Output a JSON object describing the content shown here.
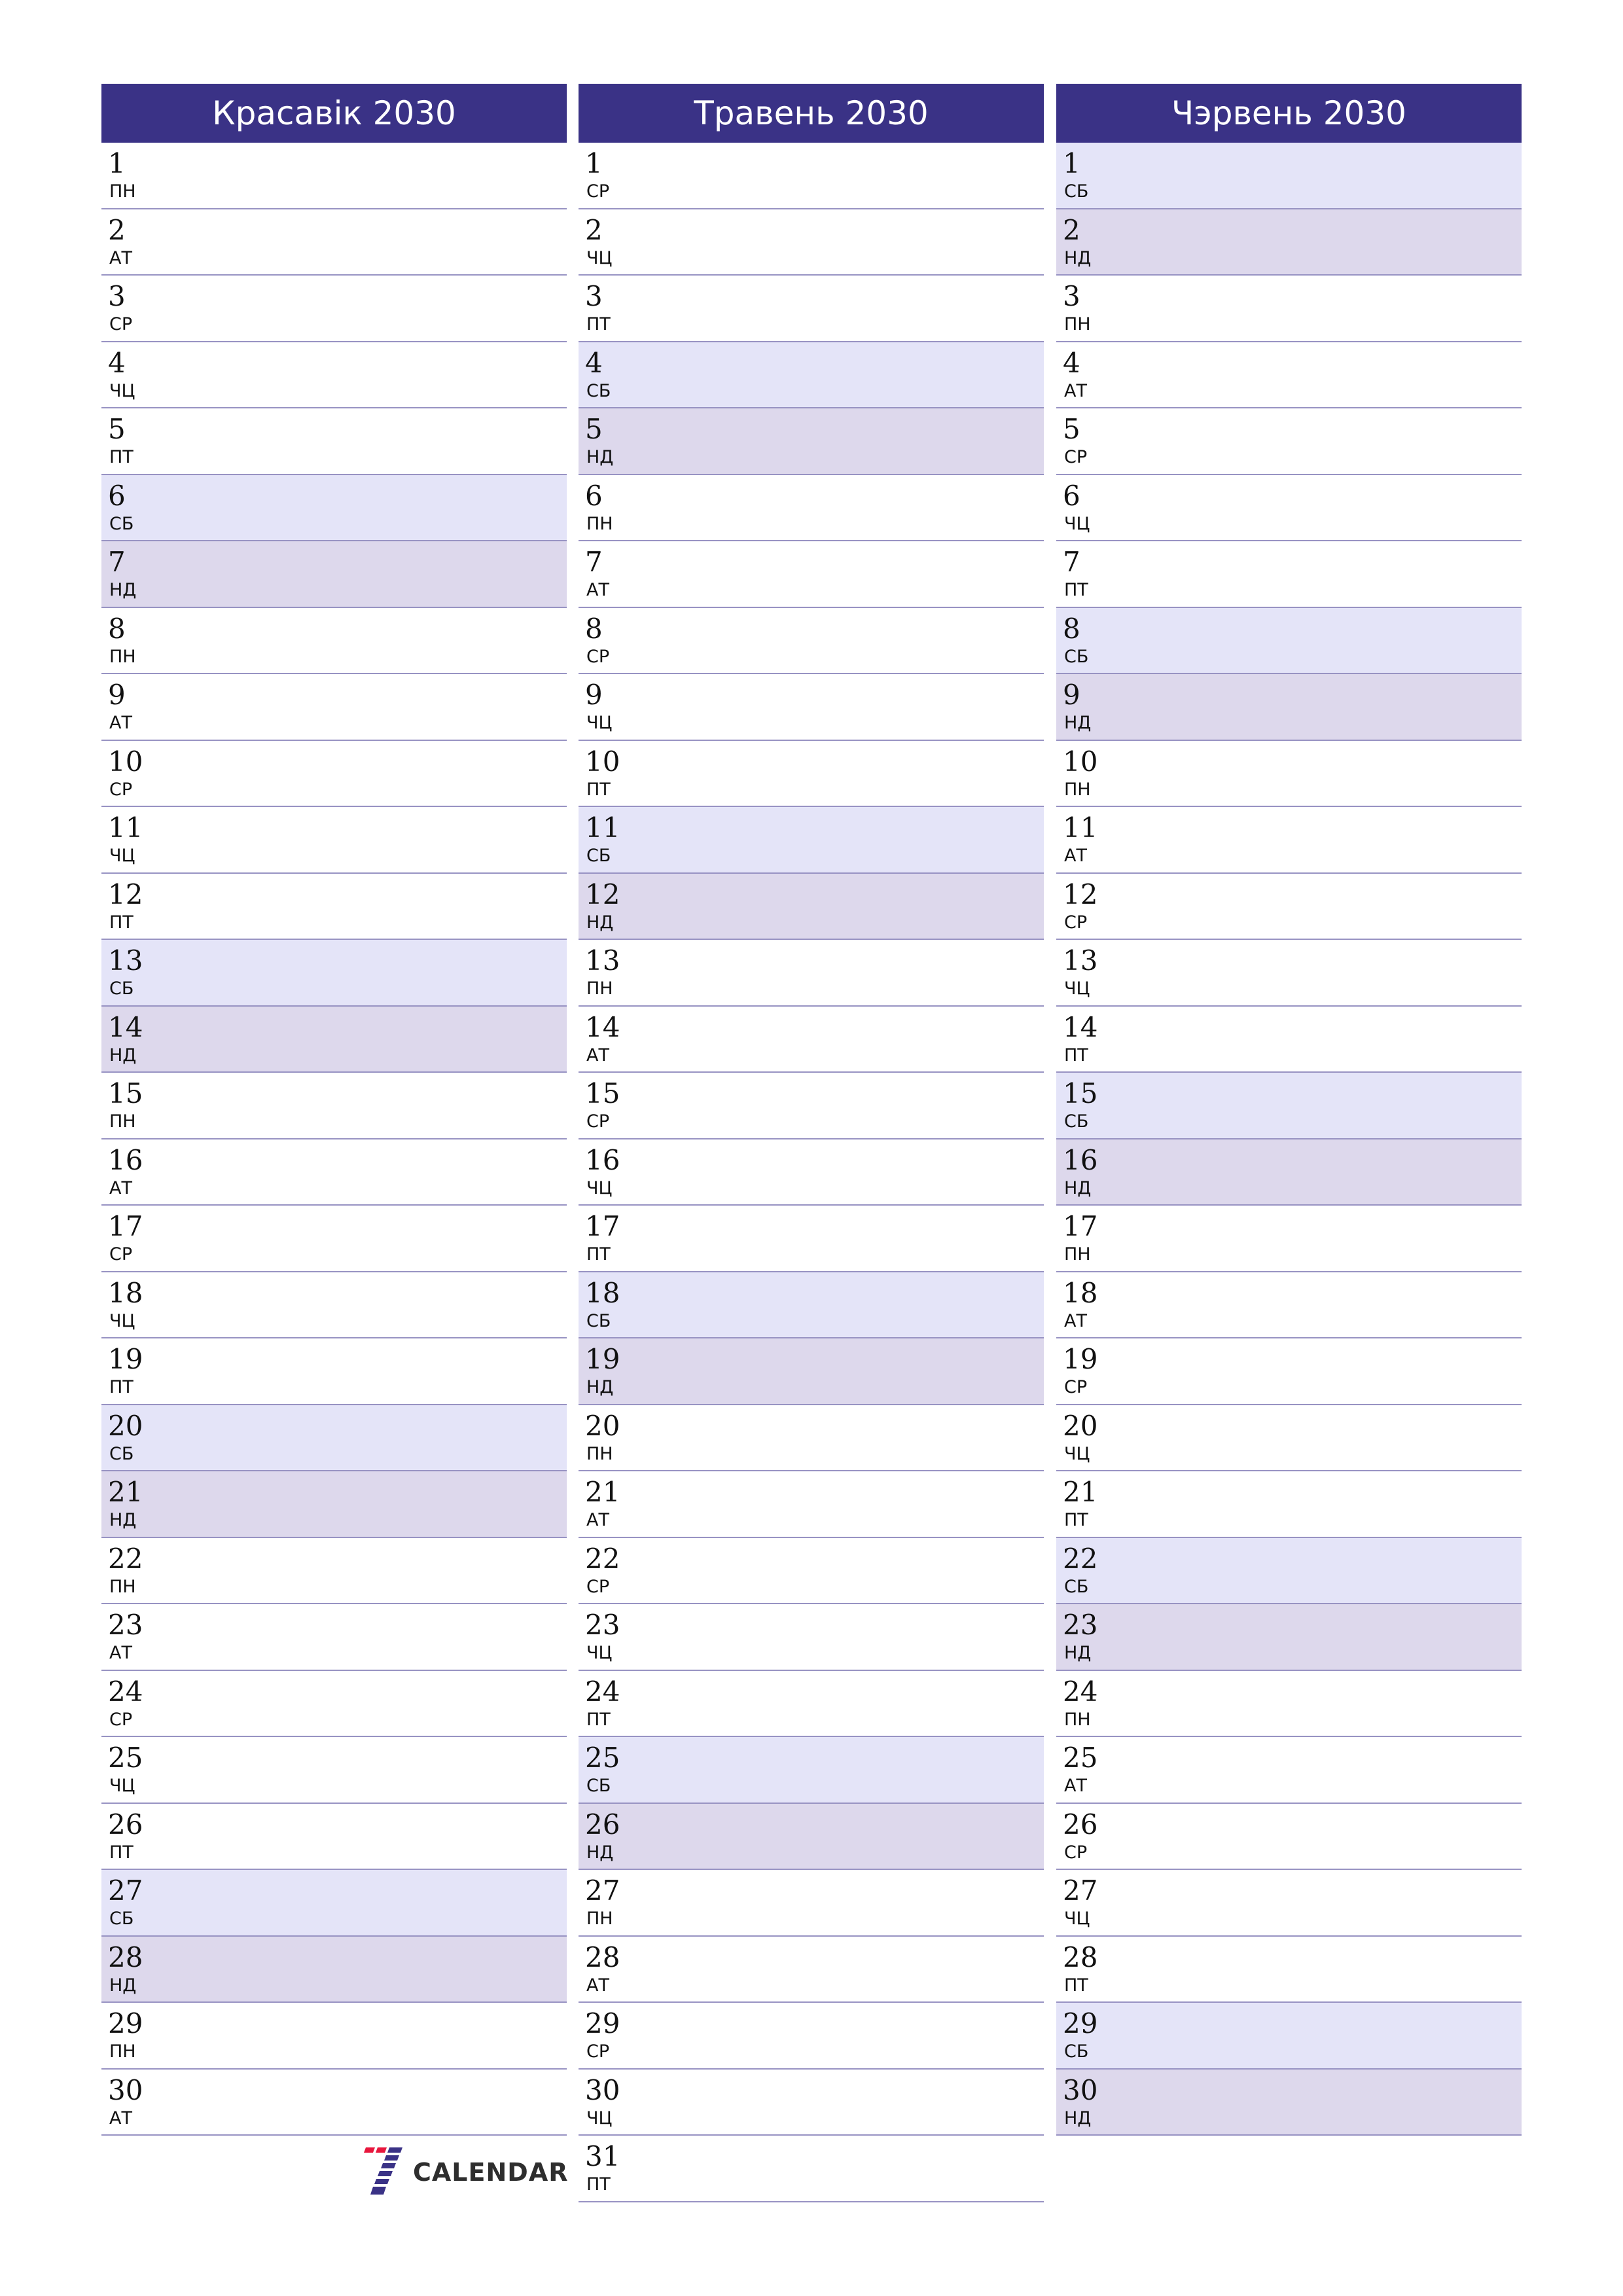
{
  "colors": {
    "header_bg": "#3a3286",
    "saturday_bg": "#e4e4f8",
    "sunday_bg": "#ddd8ec",
    "divider": "#9893c3"
  },
  "months": [
    {
      "title": "Красавік 2030",
      "days": [
        {
          "n": "1",
          "w": "ПН"
        },
        {
          "n": "2",
          "w": "АТ"
        },
        {
          "n": "3",
          "w": "СР"
        },
        {
          "n": "4",
          "w": "ЧЦ"
        },
        {
          "n": "5",
          "w": "ПТ"
        },
        {
          "n": "6",
          "w": "СБ"
        },
        {
          "n": "7",
          "w": "НД"
        },
        {
          "n": "8",
          "w": "ПН"
        },
        {
          "n": "9",
          "w": "АТ"
        },
        {
          "n": "10",
          "w": "СР"
        },
        {
          "n": "11",
          "w": "ЧЦ"
        },
        {
          "n": "12",
          "w": "ПТ"
        },
        {
          "n": "13",
          "w": "СБ"
        },
        {
          "n": "14",
          "w": "НД"
        },
        {
          "n": "15",
          "w": "ПН"
        },
        {
          "n": "16",
          "w": "АТ"
        },
        {
          "n": "17",
          "w": "СР"
        },
        {
          "n": "18",
          "w": "ЧЦ"
        },
        {
          "n": "19",
          "w": "ПТ"
        },
        {
          "n": "20",
          "w": "СБ"
        },
        {
          "n": "21",
          "w": "НД"
        },
        {
          "n": "22",
          "w": "ПН"
        },
        {
          "n": "23",
          "w": "АТ"
        },
        {
          "n": "24",
          "w": "СР"
        },
        {
          "n": "25",
          "w": "ЧЦ"
        },
        {
          "n": "26",
          "w": "ПТ"
        },
        {
          "n": "27",
          "w": "СБ"
        },
        {
          "n": "28",
          "w": "НД"
        },
        {
          "n": "29",
          "w": "ПН"
        },
        {
          "n": "30",
          "w": "АТ"
        }
      ]
    },
    {
      "title": "Травень 2030",
      "days": [
        {
          "n": "1",
          "w": "СР"
        },
        {
          "n": "2",
          "w": "ЧЦ"
        },
        {
          "n": "3",
          "w": "ПТ"
        },
        {
          "n": "4",
          "w": "СБ"
        },
        {
          "n": "5",
          "w": "НД"
        },
        {
          "n": "6",
          "w": "ПН"
        },
        {
          "n": "7",
          "w": "АТ"
        },
        {
          "n": "8",
          "w": "СР"
        },
        {
          "n": "9",
          "w": "ЧЦ"
        },
        {
          "n": "10",
          "w": "ПТ"
        },
        {
          "n": "11",
          "w": "СБ"
        },
        {
          "n": "12",
          "w": "НД"
        },
        {
          "n": "13",
          "w": "ПН"
        },
        {
          "n": "14",
          "w": "АТ"
        },
        {
          "n": "15",
          "w": "СР"
        },
        {
          "n": "16",
          "w": "ЧЦ"
        },
        {
          "n": "17",
          "w": "ПТ"
        },
        {
          "n": "18",
          "w": "СБ"
        },
        {
          "n": "19",
          "w": "НД"
        },
        {
          "n": "20",
          "w": "ПН"
        },
        {
          "n": "21",
          "w": "АТ"
        },
        {
          "n": "22",
          "w": "СР"
        },
        {
          "n": "23",
          "w": "ЧЦ"
        },
        {
          "n": "24",
          "w": "ПТ"
        },
        {
          "n": "25",
          "w": "СБ"
        },
        {
          "n": "26",
          "w": "НД"
        },
        {
          "n": "27",
          "w": "ПН"
        },
        {
          "n": "28",
          "w": "АТ"
        },
        {
          "n": "29",
          "w": "СР"
        },
        {
          "n": "30",
          "w": "ЧЦ"
        },
        {
          "n": "31",
          "w": "ПТ"
        }
      ]
    },
    {
      "title": "Чэрвень 2030",
      "days": [
        {
          "n": "1",
          "w": "СБ"
        },
        {
          "n": "2",
          "w": "НД"
        },
        {
          "n": "3",
          "w": "ПН"
        },
        {
          "n": "4",
          "w": "АТ"
        },
        {
          "n": "5",
          "w": "СР"
        },
        {
          "n": "6",
          "w": "ЧЦ"
        },
        {
          "n": "7",
          "w": "ПТ"
        },
        {
          "n": "8",
          "w": "СБ"
        },
        {
          "n": "9",
          "w": "НД"
        },
        {
          "n": "10",
          "w": "ПН"
        },
        {
          "n": "11",
          "w": "АТ"
        },
        {
          "n": "12",
          "w": "СР"
        },
        {
          "n": "13",
          "w": "ЧЦ"
        },
        {
          "n": "14",
          "w": "ПТ"
        },
        {
          "n": "15",
          "w": "СБ"
        },
        {
          "n": "16",
          "w": "НД"
        },
        {
          "n": "17",
          "w": "ПН"
        },
        {
          "n": "18",
          "w": "АТ"
        },
        {
          "n": "19",
          "w": "СР"
        },
        {
          "n": "20",
          "w": "ЧЦ"
        },
        {
          "n": "21",
          "w": "ПТ"
        },
        {
          "n": "22",
          "w": "СБ"
        },
        {
          "n": "23",
          "w": "НД"
        },
        {
          "n": "24",
          "w": "ПН"
        },
        {
          "n": "25",
          "w": "АТ"
        },
        {
          "n": "26",
          "w": "СР"
        },
        {
          "n": "27",
          "w": "ЧЦ"
        },
        {
          "n": "28",
          "w": "ПТ"
        },
        {
          "n": "29",
          "w": "СБ"
        },
        {
          "n": "30",
          "w": "НД"
        }
      ]
    }
  ],
  "weekend": {
    "saturday": "СБ",
    "sunday": "НД"
  },
  "logo": {
    "text": "CALENDAR",
    "icon": "seven-logo-icon"
  }
}
